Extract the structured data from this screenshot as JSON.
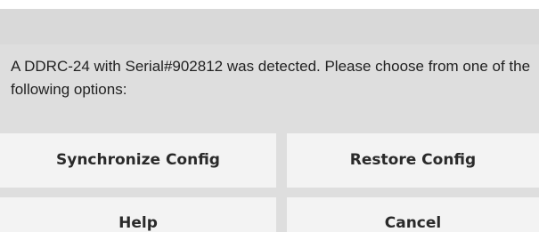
{
  "dialog": {
    "message": "A DDRC-24 with Serial#902812 was detected. Please choose from one of the following options:",
    "buttons": {
      "synchronize_label": "Synchronize Config",
      "restore_label": "Restore Config",
      "help_label": "Help",
      "cancel_label": "Cancel"
    }
  },
  "colors": {
    "dialog_background": "#dedede",
    "titlebar_background": "#d9d9d9",
    "button_background": "#f3f3f3",
    "text": "#222222"
  }
}
